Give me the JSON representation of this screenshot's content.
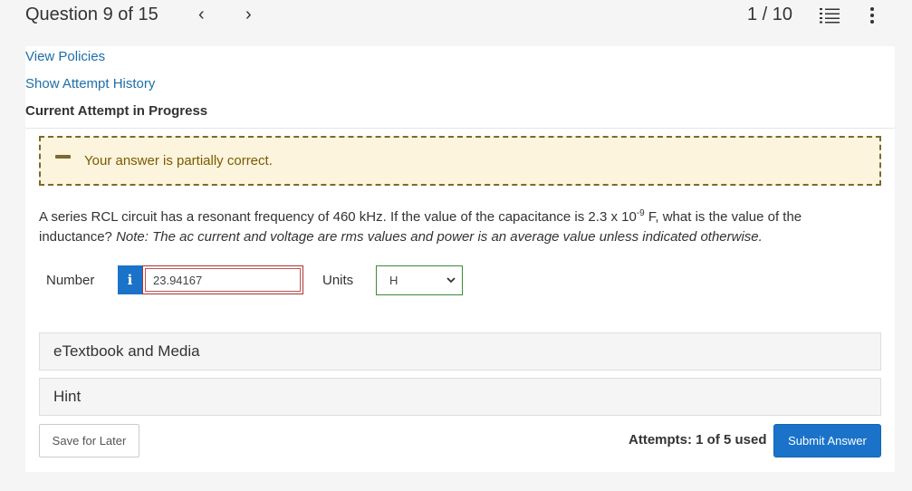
{
  "header": {
    "question_title": "Question 9 of 15",
    "prev_icon": "chevron-left-icon",
    "next_icon": "chevron-right-icon",
    "page_count": "1 / 10",
    "list_icon": "numbered-list-icon",
    "more_icon": "vertical-dots-icon"
  },
  "links": {
    "view_policies": "View Policies",
    "show_attempt_history": "Show Attempt History"
  },
  "status": {
    "current_attempt": "Current Attempt in Progress"
  },
  "feedback": {
    "text": "Your answer is partially correct.",
    "color": "#fcf4dc",
    "accent": "#7a6a2f"
  },
  "question": {
    "part1": "A series RCL circuit has a resonant frequency of 460 kHz. If the value of the capacitance is 2.3 x 10",
    "exponent": "-9",
    "part2": " F, what is the value of the inductance? ",
    "note": "Note: The ac current and voltage are rms values and power is an average value unless indicated otherwise."
  },
  "answer": {
    "number_label": "Number",
    "info_label": "i",
    "value": "23.94167",
    "units_label": "Units",
    "units_selected": "H"
  },
  "accordions": {
    "etextbook": "eTextbook and Media",
    "hint": "Hint"
  },
  "footer": {
    "save_label": "Save for Later",
    "attempts_text": "Attempts: 1 of 5 used",
    "submit_label": "Submit Answer"
  },
  "colors": {
    "primary": "#1a73c9",
    "link": "#1d6fa8"
  }
}
